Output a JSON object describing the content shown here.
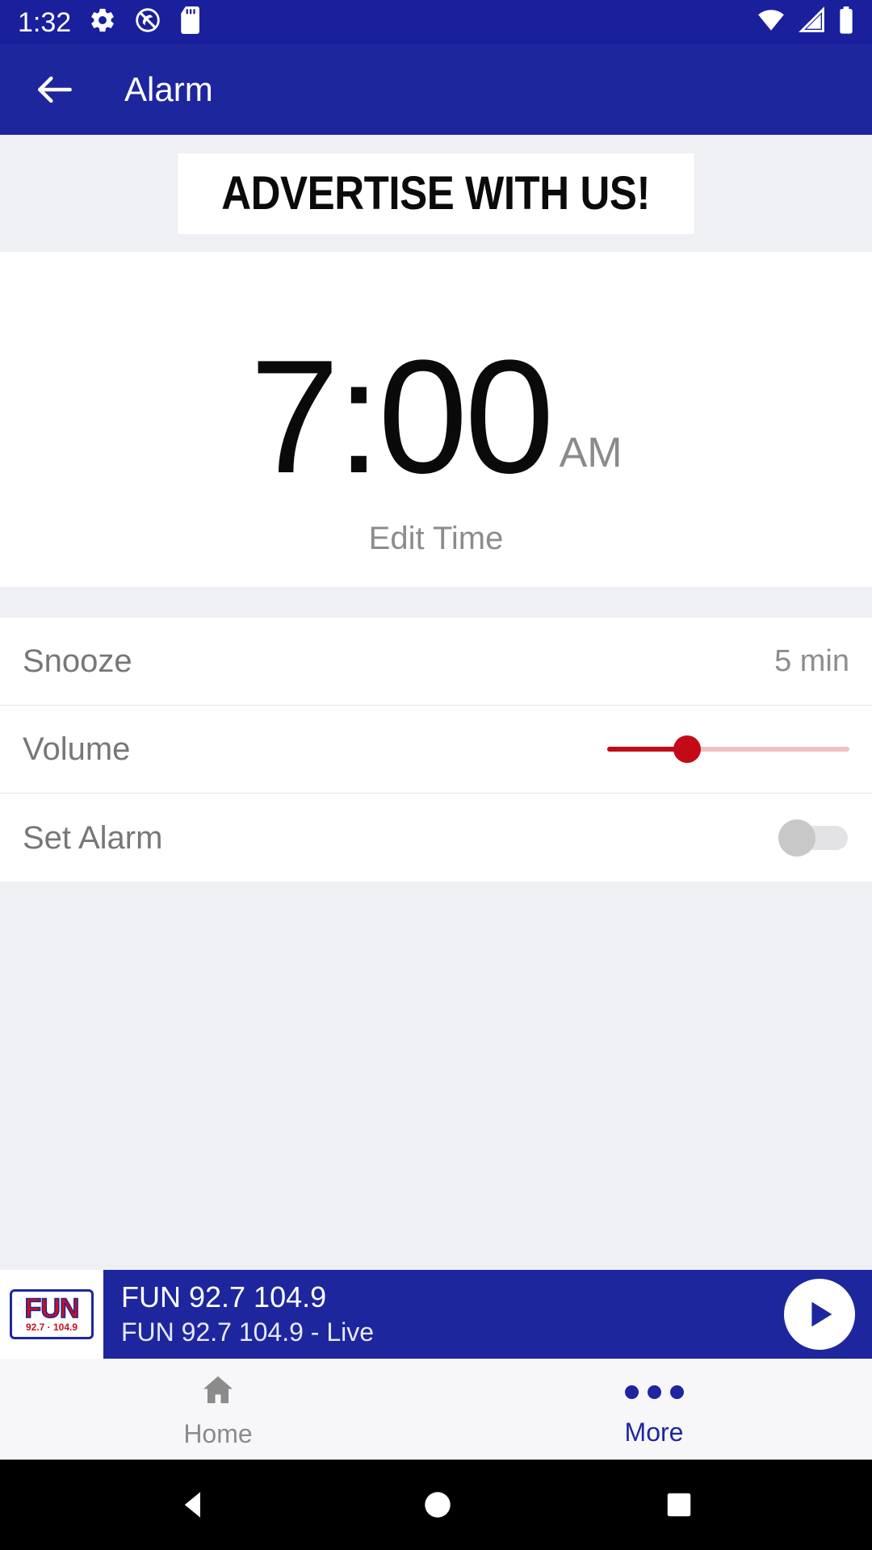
{
  "status_bar": {
    "time": "1:32",
    "left_icons": [
      "gear-icon",
      "do-not-disturb-icon",
      "sd-card-icon"
    ],
    "right_icons": [
      "wifi-icon",
      "cell-signal-icon",
      "battery-icon"
    ],
    "background": "#1a1f9c"
  },
  "app_bar": {
    "title": "Alarm",
    "back_icon": "back-arrow-icon",
    "background": "#1e269e"
  },
  "ad_banner": {
    "text": "ADVERTISE WITH US!"
  },
  "clock": {
    "time": "7:00",
    "meridiem": "AM",
    "edit_label": "Edit Time"
  },
  "settings": {
    "rows": [
      {
        "label": "Snooze",
        "value": "5 min",
        "type": "value"
      },
      {
        "label": "Volume",
        "type": "slider",
        "fill_percent": 33,
        "track_color": "#f2bfbf",
        "fill_color": "#c20b16"
      },
      {
        "label": "Set Alarm",
        "type": "toggle",
        "state": "off"
      }
    ]
  },
  "player": {
    "logo_text": "FUN",
    "logo_freq": "92.7 · 104.9",
    "title": "FUN 92.7 104.9",
    "subtitle": "FUN 92.7 104.9 - Live",
    "play_icon": "play-icon",
    "background": "#1e269e"
  },
  "bottom_nav": {
    "items": [
      {
        "label": "Home",
        "icon": "home-icon",
        "active": false
      },
      {
        "label": "More",
        "icon": "more-dots-icon",
        "active": true
      }
    ],
    "accent": "#1e269e"
  },
  "system_nav": {
    "back": "triangle-back-icon",
    "home": "circle-home-icon",
    "recents": "square-recents-icon"
  }
}
